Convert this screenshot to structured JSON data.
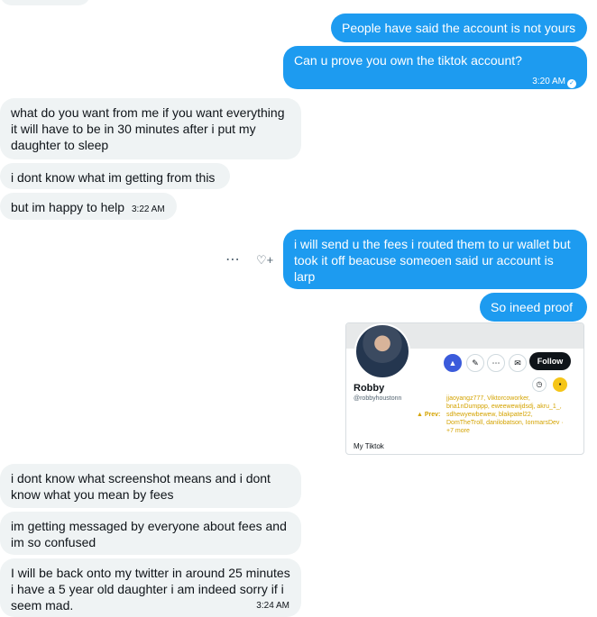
{
  "messages": {
    "m1": "People have said the account is not yours",
    "m2": "Can u prove you own the tiktok account?",
    "m2_time": "3:20 AM",
    "m3": "what do you want from me if you want everything it will have to be in 30 minutes after i put my daughter to sleep",
    "m4": "i dont know what im getting from this",
    "m5": "but im happy to help",
    "m5_time": "3:22 AM",
    "m6": "i will send u the fees i routed them to ur wallet but took it off beacuse someoen said ur account is larp",
    "m7": "So ineed proof",
    "m8": "i dont know what screenshot means and i dont know what you mean by fees",
    "m9": "im getting messaged by everyone about fees and im so confused",
    "m10": "I will be back onto my twitter in around 25 minutes i have a 5 year old daughter i am indeed sorry if i seem mad.",
    "m10_time": "3:24 AM"
  },
  "actions": {
    "more": "⋯",
    "react": "♡+"
  },
  "screenshot_card": {
    "name": "Robby",
    "handle": "@robbyhoustonn",
    "follow_label": "Follow",
    "prev_label": "▲ Prev:",
    "prev_names": "jjaoyangz777, Viktorcoworker, bna1nDumppp, eweewewijdsdj, akru_1_, sdhewyewbewew, blakpatel22, DomTheTroll, danilobatson, IonmarsDev · +7 more",
    "my_tiktok_label": "My Tiktok"
  },
  "colors": {
    "outgoing": "#1d9bf0",
    "incoming": "#eff3f4"
  }
}
